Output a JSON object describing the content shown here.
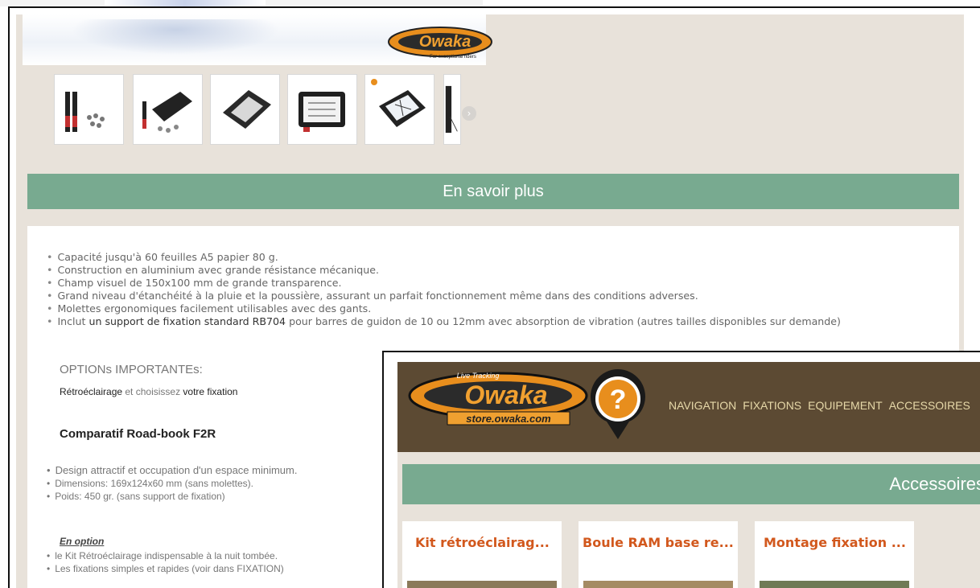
{
  "banner": {
    "logo_text": "Owaka",
    "logo_tagline": "For exceptional riders"
  },
  "gallery": {
    "thumbnails": [
      "product-image-1",
      "product-image-2",
      "product-image-3",
      "product-image-4",
      "product-image-5",
      "product-image-6"
    ],
    "next_arrow": "›"
  },
  "section": {
    "title": "En savoir plus"
  },
  "features": {
    "items": [
      "Capacité jusqu'à 60 feuilles A5 papier 80 g.",
      "Construction en aluminium avec grande résistance mécanique.",
      "Champ visuel de 150x100 mm de grande transparence.",
      "Grand niveau d'étanchéité à la pluie et la poussière, assurant un parfait fonctionnement même dans des conditions adverses.",
      "Molettes ergonomiques facilement utilisables avec des gants."
    ],
    "last_prefix": "Inclut ",
    "last_strong": "un support de fixation standard RB704",
    "last_suffix": " pour barres de guidon de 10 ou 12mm avec absorption de vibration (autres tailles disponibles sur demande)"
  },
  "options": {
    "title": "OPTIONs IMPORTANTEs:",
    "part1": "Rétroéclairage",
    "part2": " et choisissez ",
    "part3": "votre fixation"
  },
  "comparatif": {
    "title": "Comparatif Road-book F2R"
  },
  "specs": [
    "Design attractif et occupation d'un espace minimum.",
    "Dimensions: 169x124x60 mm (sans molettes).",
    "Poids: 450 gr. (sans support de fixation)"
  ],
  "option_section": {
    "heading": "En option",
    "items": [
      "le Kit Rétroéclairage indispensable à la nuit tombée.",
      "Les fixations simples et rapides (voir dans FIXATION)"
    ]
  },
  "overlay": {
    "logo_text": "Owaka",
    "logo_tracking": "Live Tracking",
    "logo_store": "store.owaka.com",
    "logo_question": "?",
    "nav": [
      "NAVIGATION",
      "FIXATIONS",
      "EQUIPEMENT",
      "ACCESSOIRES"
    ],
    "bar_title": "Accessoires",
    "cards": [
      "Kit rétroéclairag...",
      "Boule RAM base re...",
      "Montage fixation ..."
    ]
  },
  "colors": {
    "accent_green": "#78aa90",
    "header_brown": "#5c4a33",
    "card_title": "#d2581d",
    "beige": "#e8e2da"
  }
}
